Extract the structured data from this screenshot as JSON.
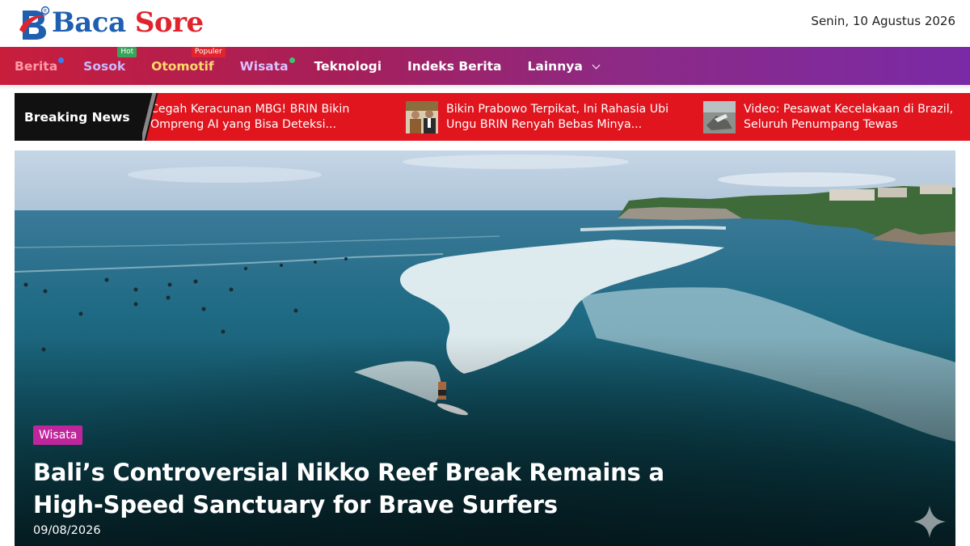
{
  "header": {
    "logo_word1": "Baca",
    "logo_word2": "Sore",
    "date": "Senin, 10 Agustus 2026"
  },
  "nav": {
    "items": [
      {
        "label": "Berita"
      },
      {
        "label": "Sosok",
        "badge": "Hot"
      },
      {
        "label": "Otomotif",
        "badge": "Populer"
      },
      {
        "label": "Wisata"
      },
      {
        "label": "Teknologi"
      },
      {
        "label": "Indeks Berita"
      },
      {
        "label": "Lainnya"
      }
    ]
  },
  "breaking": {
    "label": "Breaking News",
    "items": [
      {
        "text": "Cegah Keracunan MBG! BRIN Bikin Ompreng AI yang Bisa Deteksi..."
      },
      {
        "text": "Bikin Prabowo Terpikat, Ini Rahasia Ubi Ungu BRIN Renyah Bebas Minya..."
      },
      {
        "text": "Video: Pesawat Kecelakaan di Brazil, Seluruh Penumpang Tewas"
      }
    ]
  },
  "hero": {
    "category": "Wisata",
    "title": "Bali’s Controversial Nikko Reef Break Remains a High-Speed Sanctuary for Brave Surfers",
    "date": "09/08/2026"
  },
  "colors": {
    "logo_blue": "#1f5fb0",
    "logo_red": "#e0232c",
    "breaking_red": "#e0151e",
    "tag_magenta": "#c0269c"
  }
}
